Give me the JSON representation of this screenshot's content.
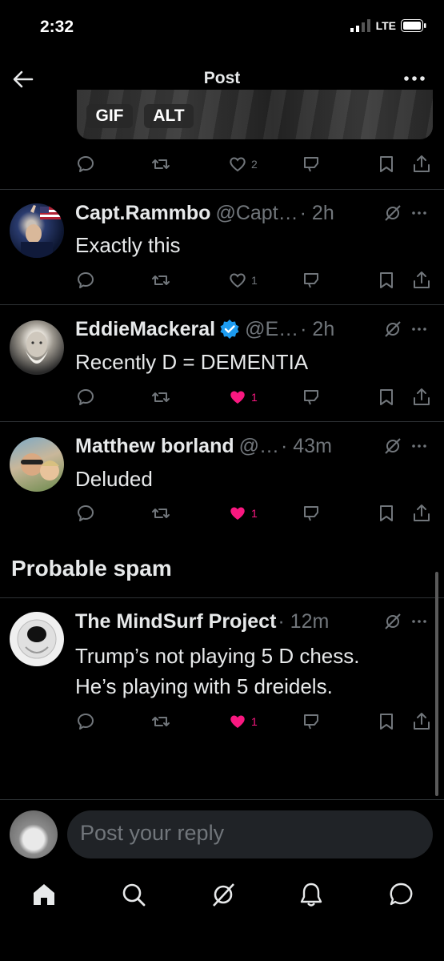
{
  "status_bar": {
    "time": "2:32",
    "network": "LTE"
  },
  "header": {
    "title": "Post"
  },
  "media": {
    "gif_label": "GIF",
    "alt_label": "ALT"
  },
  "first_post": {
    "likes": "2"
  },
  "replies": [
    {
      "name": "Capt.Rammbo",
      "handle": "@Capt…",
      "time": "· 2h",
      "text": "Exactly this",
      "likes": "1",
      "liked": false,
      "verified": false
    },
    {
      "name": "EddieMackeral",
      "handle": "@E…",
      "time": "· 2h",
      "text": "Recently D = DEMENTIA",
      "likes": "1",
      "liked": true,
      "verified": true
    },
    {
      "name": "Matthew borland",
      "handle": "@…",
      "time": "· 43m",
      "text": "Deluded",
      "likes": "1",
      "liked": true,
      "verified": false
    }
  ],
  "spam_section": {
    "title": "Probable spam",
    "reply": {
      "name": "The MindSurf Project",
      "handle": "",
      "time": "· 12m",
      "text_line1": "Trump’s not playing 5 D chess.",
      "text_line2": "He’s playing with 5 dreidels.",
      "likes": "1",
      "liked": true
    }
  },
  "composer": {
    "placeholder": "Post your reply"
  },
  "colors": {
    "background": "#000000",
    "text": "#e7e9ea",
    "muted": "#71767b",
    "like": "#f91880",
    "verified": "#1d9bf0"
  },
  "icons": [
    "back-arrow-icon",
    "more-icon",
    "reply-icon",
    "repost-icon",
    "like-icon",
    "views-icon",
    "bookmark-icon",
    "share-icon",
    "grok-icon",
    "home-icon",
    "search-icon",
    "notifications-icon",
    "messages-icon"
  ]
}
